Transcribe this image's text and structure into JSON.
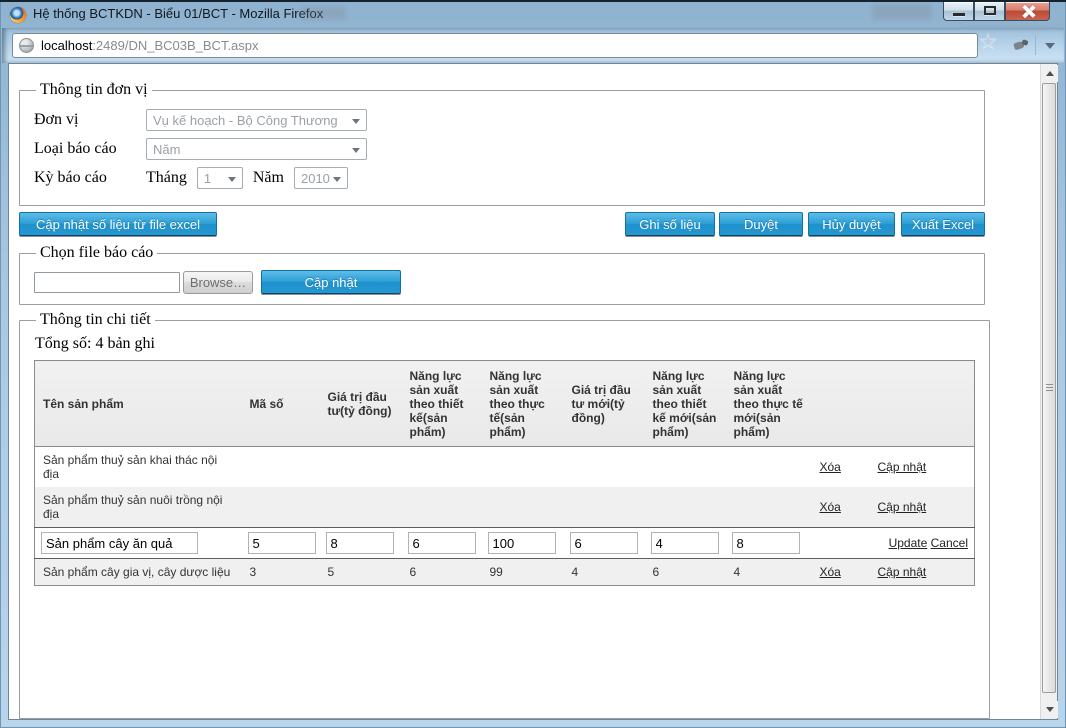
{
  "window": {
    "title": "Hệ thống BCTKDN - Biểu 01/BCT - Mozilla Firefox"
  },
  "browser": {
    "url_host": "localhost",
    "url_path": ":2489/DN_BC03B_BCT.aspx",
    "star_icon_glyph": "☆"
  },
  "unit_fieldset": {
    "legend": "Thông tin đơn vị",
    "unit_label": "Đơn vị",
    "unit_value": "Vụ kế hoạch - Bộ Công Thương",
    "report_type_label": "Loại báo cáo",
    "report_type_value": "Năm",
    "period_label": "Kỳ báo cáo",
    "month_label": "Tháng",
    "month_value": "1",
    "year_label": "Năm",
    "year_value": "2010"
  },
  "toolbar": {
    "update_from_excel": "Cập nhật số liệu từ file excel",
    "save": "Ghi số liệu",
    "approve": "Duyệt",
    "unapprove": "Hủy duyệt",
    "export_excel": "Xuất Excel"
  },
  "file_fieldset": {
    "legend": "Chọn file báo cáo",
    "file_value": "",
    "browse": "Browse…",
    "update": "Cập nhật"
  },
  "detail_fieldset": {
    "legend": "Thông tin chi tiết",
    "total": "Tổng số: 4 bản ghi",
    "table": {
      "headers": [
        "Tên sản phẩm",
        "Mã số",
        "Giá trị đầu tư(tỷ đồng)",
        "Năng lực sản xuất theo thiết kế(sản phẩm)",
        "Năng lực sản xuất theo thực tế(sản phẩm)",
        "Giá trị đầu tư mới(tỷ đồng)",
        "Năng lực sản xuất theo thiết kế mới(sản phẩm)",
        "Năng lực sản xuất theo thực tế mới(sản phẩm)"
      ],
      "rows": [
        {
          "name": "Sản phẩm thuỷ sản khai thác nội địa",
          "values": [
            "",
            "",
            "",
            "",
            "",
            "",
            ""
          ],
          "delete": "Xóa",
          "update": "Cập nhật"
        },
        {
          "name": "Sản phẩm thuỷ sản nuôi trồng nội địa",
          "values": [
            "",
            "",
            "",
            "",
            "",
            "",
            ""
          ],
          "delete": "Xóa",
          "update": "Cập nhật"
        },
        {
          "name_input": "Sản phẩm cây ăn quả",
          "inputs": [
            "5",
            "8",
            "6",
            "100",
            "6",
            "4",
            "8"
          ],
          "update": "Update",
          "cancel": "Cancel"
        },
        {
          "name": "Sản phẩm cây gia vị, cây dược liệu",
          "values": [
            "3",
            "5",
            "6",
            "99",
            "4",
            "6",
            "4"
          ],
          "delete": "Xóa",
          "update": "Cập nhật"
        }
      ]
    }
  }
}
